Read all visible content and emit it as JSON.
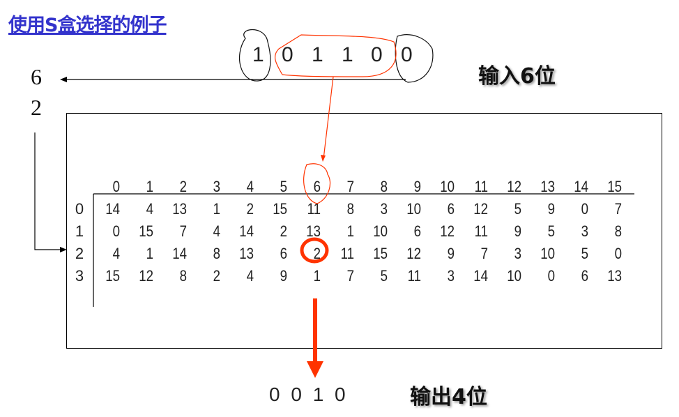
{
  "title": "使用S盒选择的例子",
  "input_bits": [
    "1",
    "0",
    "1",
    "1",
    "0",
    "0"
  ],
  "input_label": "输入6位",
  "row_value": "2",
  "col_value": "6",
  "sbox": {
    "column_headers": [
      "0",
      "1",
      "2",
      "3",
      "4",
      "5",
      "6",
      "7",
      "8",
      "9",
      "10",
      "11",
      "12",
      "13",
      "14",
      "15"
    ],
    "row_headers": [
      "0",
      "1",
      "2",
      "3"
    ],
    "rows": [
      [
        "14",
        "4",
        "13",
        "1",
        "2",
        "15",
        "11",
        "8",
        "3",
        "10",
        "6",
        "12",
        "5",
        "9",
        "0",
        "7"
      ],
      [
        "0",
        "15",
        "7",
        "4",
        "14",
        "2",
        "13",
        "1",
        "10",
        "6",
        "12",
        "11",
        "9",
        "5",
        "3",
        "8"
      ],
      [
        "4",
        "1",
        "14",
        "8",
        "13",
        "6",
        "2",
        "11",
        "15",
        "12",
        "9",
        "7",
        "3",
        "10",
        "5",
        "0"
      ],
      [
        "15",
        "12",
        "8",
        "2",
        "4",
        "9",
        "1",
        "7",
        "5",
        "11",
        "3",
        "14",
        "10",
        "0",
        "6",
        "13"
      ]
    ],
    "highlighted": {
      "row": 2,
      "col": 6
    }
  },
  "output_bits": "0 0 1 0",
  "output_label": "输出4位",
  "colors": {
    "title": "#3333cc",
    "highlight": "#ff3300"
  }
}
